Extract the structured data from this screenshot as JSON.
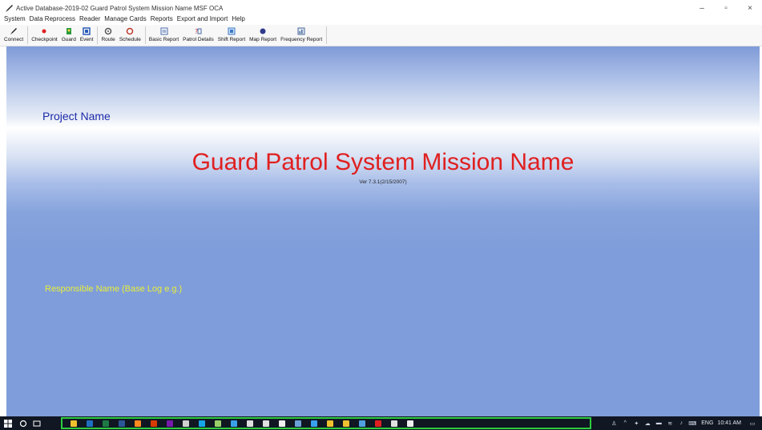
{
  "window": {
    "title": "Active Database-2019-02  Guard Patrol System Mission Name   MSF OCA",
    "minimize_glyph": "–",
    "maximize_glyph": "▫",
    "close_glyph": "×"
  },
  "menu": [
    "System",
    "Data Reprocess",
    "Reader",
    "Manage Cards",
    "Reports",
    "Export and Import",
    "Help"
  ],
  "toolbar": [
    {
      "label": "Connect",
      "icon": "pen-icon",
      "color": "#222222"
    },
    {
      "label": "Checkpoint",
      "icon": "checkpoint-icon",
      "color": "#e02020"
    },
    {
      "label": "Guard",
      "icon": "guard-icon",
      "color": "#2a9a3a"
    },
    {
      "label": "Event",
      "icon": "event-icon",
      "color": "#2a5ab8"
    },
    {
      "label": "Route",
      "icon": "route-icon",
      "color": "#555555"
    },
    {
      "label": "Schedule",
      "icon": "schedule-icon",
      "color": "#c0392b"
    },
    {
      "label": "Basic Report",
      "icon": "basic-report-icon",
      "color": "#4a6aa8"
    },
    {
      "label": "Patrol Details",
      "icon": "patrol-details-icon",
      "color": "#c04040"
    },
    {
      "label": "Shift Report",
      "icon": "shift-report-icon",
      "color": "#3a7ac8"
    },
    {
      "label": "Map Report",
      "icon": "map-report-icon",
      "color": "#303a8a"
    },
    {
      "label": "Frequency Report",
      "icon": "frequency-report-icon",
      "color": "#4a6a9a"
    }
  ],
  "main": {
    "project_name": "Project Name",
    "mission_name": "Guard Patrol System Mission Name",
    "version": "Ver 7.3.1(2/15/2007)",
    "responsible": "Responsible Name (Base Log e.g.)"
  },
  "taskbar": {
    "apps": [
      {
        "icon": "file-explorer-icon",
        "color": "#f2c12e"
      },
      {
        "icon": "outlook-icon",
        "color": "#1f6fc1"
      },
      {
        "icon": "excel-icon",
        "color": "#1e7a45"
      },
      {
        "icon": "word-icon",
        "color": "#2b5797"
      },
      {
        "icon": "firefox-icon",
        "color": "#ff8a1f"
      },
      {
        "icon": "office-icon",
        "color": "#d83b01"
      },
      {
        "icon": "onenote-icon",
        "color": "#7719aa"
      },
      {
        "icon": "calculator-icon",
        "color": "#d0d0d0"
      },
      {
        "icon": "skype-icon",
        "color": "#16a4e8"
      },
      {
        "icon": "paint-icon",
        "color": "#9ad06a"
      },
      {
        "icon": "onedrive-icon",
        "color": "#3aa0e8"
      },
      {
        "icon": "terminal-icon",
        "color": "#e0e0e0"
      },
      {
        "icon": "cloud-icon",
        "color": "#e0e0e0"
      },
      {
        "icon": "notes-icon",
        "color": "#f0f0f0"
      },
      {
        "icon": "image-app-icon",
        "color": "#6aa0d8"
      },
      {
        "icon": "edge-icon",
        "color": "#3aa0f0"
      },
      {
        "icon": "sticky-notes-icon",
        "color": "#f2c12e"
      },
      {
        "icon": "chrome-icon",
        "color": "#f0c030"
      },
      {
        "icon": "settings-app-icon",
        "color": "#50a0e0"
      },
      {
        "icon": "acrobat-icon",
        "color": "#e02020"
      },
      {
        "icon": "photos-icon",
        "color": "#e0e0e0"
      },
      {
        "icon": "guard-app-icon",
        "color": "#f0f0f0"
      }
    ],
    "tray": {
      "language": "ENG",
      "time": "10:41 AM"
    }
  }
}
